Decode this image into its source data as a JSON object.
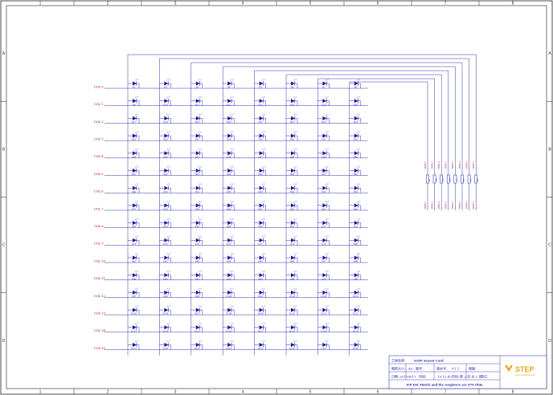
{
  "frame": {
    "columns": [
      "1",
      "2",
      "3",
      "4",
      "5",
      "6",
      "7",
      "8"
    ],
    "rows": [
      "A",
      "B",
      "C",
      "D"
    ]
  },
  "matrix": {
    "col_labels": [
      "COL 0",
      "COL 1",
      "COL 2",
      "COL 3",
      "COL 4",
      "COL 5",
      "COL 6",
      "COL 7",
      "COL 8",
      "COL 9",
      "COL 10",
      "COL 11",
      "COL 12",
      "COL 13",
      "COL 14",
      "COL 15"
    ],
    "diode_count": 128,
    "diodes_per_row": 8
  },
  "resistors": {
    "labels": [
      "R1",
      "R2",
      "R3",
      "R4",
      "R5",
      "R6",
      "R7",
      "R8"
    ],
    "top_labels": [
      "ROW 0",
      "ROW 1",
      "ROW 2",
      "ROW 3",
      "ROW 4",
      "ROW 5",
      "ROW 6",
      "ROW 7"
    ],
    "bottom_labels": [
      "ROW 0",
      "ROW 1",
      "ROW 2",
      "ROW 3",
      "ROW 4",
      "ROW 5",
      "ROW 6",
      "ROW 7"
    ]
  },
  "title_block": {
    "project_label": "工程名称：",
    "project_value": "STEP Sensor Card",
    "size_label": "图纸大小：",
    "size_value": "A3",
    "drawno_label": "图号：",
    "drawno_value": "",
    "version_label": "版本号：",
    "version_value": "V1.1",
    "drawer_label": "制图：",
    "drawer_value": "",
    "date_label": "日期：",
    "date_value": "2017/6/17",
    "time_label": "时间：",
    "time_value": "13:12:42",
    "page_label": "页码：",
    "page_value": "第 2 页 共 2 页",
    "unit_label": "单位：",
    "unit_value": "",
    "note": "8*8 Dot Matrix and the resgisters are 470 Ohm",
    "logo_text": "STEP",
    "logo_sub": "www.stepfpga.com"
  }
}
